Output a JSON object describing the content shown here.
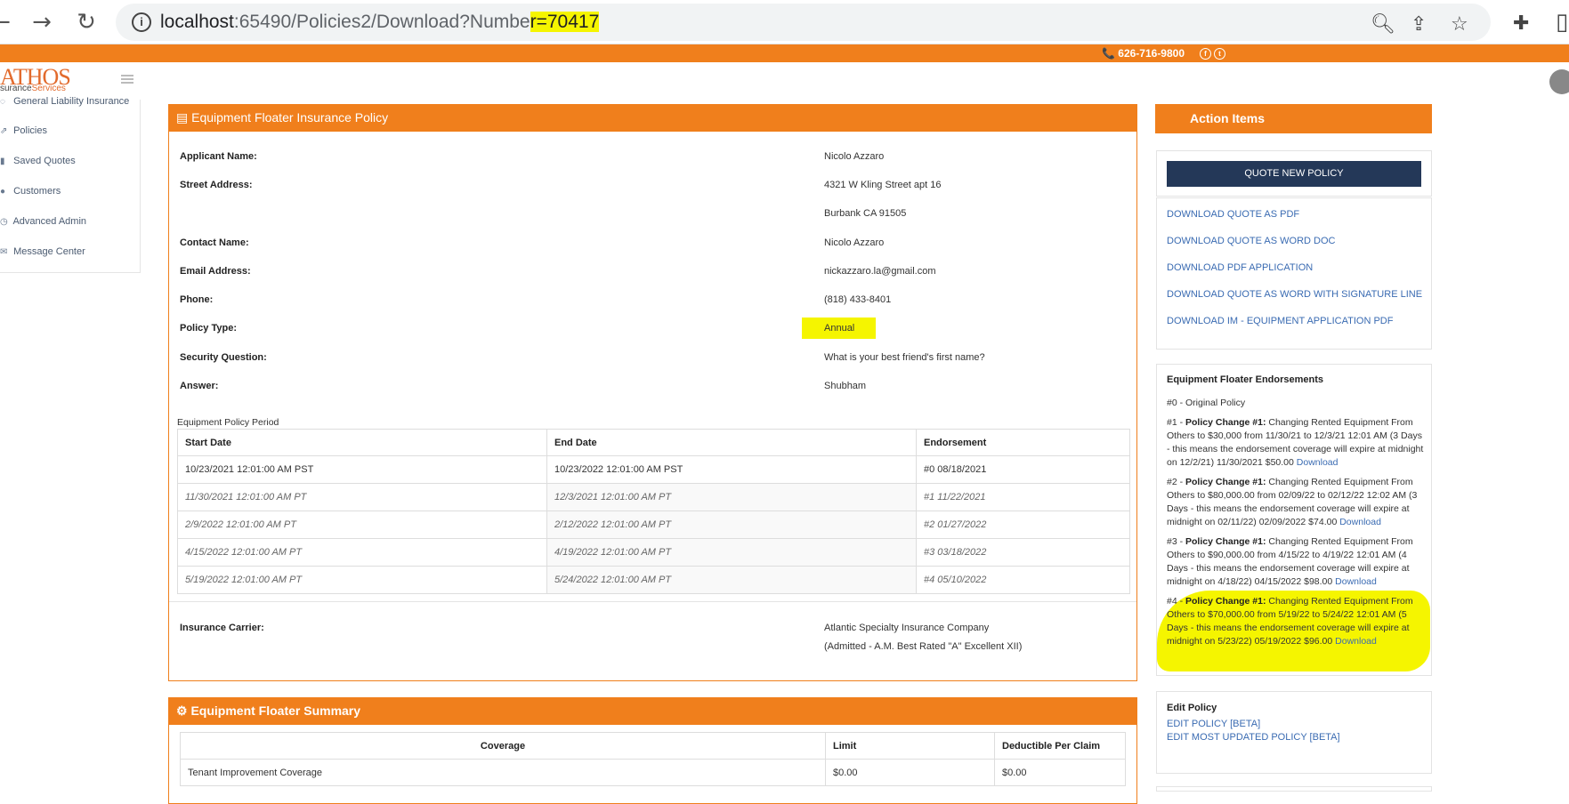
{
  "browser": {
    "url_host": "localhost",
    "url_path_pre": ":65490/Policies2/Download?Numbe",
    "url_highlighted": "r=70417"
  },
  "topbar": {
    "phone": "📞 626-716-9800"
  },
  "logo": {
    "main": "ATHOS",
    "sub_a": "surance",
    "sub_b": "Services"
  },
  "sidebar": {
    "items": [
      {
        "label": "General Liability Insurance",
        "icon": "shield-icon"
      },
      {
        "label": "Policies",
        "icon": "external-link-icon"
      },
      {
        "label": "Saved Quotes",
        "icon": "bookmark-icon"
      },
      {
        "label": "Customers",
        "icon": "users-icon"
      },
      {
        "label": "Advanced Admin",
        "icon": "clock-icon"
      },
      {
        "label": "Message Center",
        "icon": "envelope-icon"
      }
    ]
  },
  "policy": {
    "title": "Equipment Floater Insurance Policy",
    "fields": [
      {
        "label": "Applicant Name:",
        "value": "Nicolo Azzaro"
      },
      {
        "label": "Street Address:",
        "value": "4321 W Kling Street apt 16"
      },
      {
        "label": "",
        "value": "Burbank CA 91505"
      },
      {
        "label": "Contact Name:",
        "value": "Nicolo Azzaro"
      },
      {
        "label": "Email Address:",
        "value": "nickazzaro.la@gmail.com"
      },
      {
        "label": "Phone:",
        "value": "(818) 433-8401"
      },
      {
        "label": "Policy Type:",
        "value": "Annual"
      },
      {
        "label": "Security Question:",
        "value": "What is your best friend's first name?"
      },
      {
        "label": "Answer:",
        "value": "Shubham"
      }
    ],
    "period_caption": "Equipment Policy Period",
    "period_headers": [
      "Start Date",
      "End Date",
      "Endorsement"
    ],
    "period_rows": [
      [
        "10/23/2021 12:01:00 AM PST",
        "10/23/2022 12:01:00 AM PST",
        "#0 08/18/2021"
      ],
      [
        "11/30/2021 12:01:00 AM PT",
        "12/3/2021 12:01:00 AM PT",
        "#1  11/22/2021"
      ],
      [
        "2/9/2022 12:01:00 AM PT",
        "2/12/2022 12:01:00 AM PT",
        "#2  01/27/2022"
      ],
      [
        "4/15/2022 12:01:00 AM PT",
        "4/19/2022 12:01:00 AM PT",
        "#3  03/18/2022"
      ],
      [
        "5/19/2022 12:01:00 AM PT",
        "5/24/2022 12:01:00 AM PT",
        "#4  05/10/2022"
      ]
    ],
    "carrier_label": "Insurance Carrier:",
    "carrier_name": "Atlantic Specialty Insurance Company",
    "carrier_rating": "(Admitted - A.M. Best Rated \"A\" Excellent XII)"
  },
  "summary": {
    "title": "Equipment Floater Summary",
    "headers": [
      "Coverage",
      "Limit",
      "Deductible Per Claim"
    ],
    "rows": [
      [
        "Tenant Improvement Coverage",
        "$0.00",
        "$0.00"
      ]
    ]
  },
  "actions": {
    "title": "Action Items",
    "quote_button": "QUOTE NEW POLICY",
    "links": [
      "DOWNLOAD QUOTE AS PDF",
      "DOWNLOAD QUOTE AS WORD DOC",
      "DOWNLOAD PDF APPLICATION",
      "DOWNLOAD QUOTE AS WORD WITH SIGNATURE LINE",
      "DOWNLOAD IM - EQUIPMENT APPLICATION PDF"
    ],
    "endorsements_title": "Equipment Floater Endorsements",
    "endorsement0": "#0 - Original Policy",
    "endorsements": [
      {
        "num": "#1 - ",
        "bold": "Policy Change #1:",
        "text": " Changing Rented Equipment From Others to $30,000 from 11/30/21 to 12/3/21 12:01 AM (3 Days - this means the endorsement coverage will expire at midnight on 12/2/21) 11/30/2021 $50.00 ",
        "link": "Download"
      },
      {
        "num": "#2 - ",
        "bold": "Policy Change #1:",
        "text": " Changing Rented Equipment From Others to $80,000.00 from 02/09/22 to 02/12/22 12:02 AM (3 Days - this means the endorsement coverage will expire at midnight on 02/11/22) 02/09/2022 $74.00 ",
        "link": "Download"
      },
      {
        "num": "#3 - ",
        "bold": "Policy Change #1:",
        "text": " Changing Rented Equipment From Others to $90,000.00 from 4/15/22 to 4/19/22 12:01 AM (4 Days - this means the endorsement coverage will expire at midnight on 4/18/22) 04/15/2022 $98.00 ",
        "link": "Download"
      },
      {
        "num": "#4 - ",
        "bold": "Policy Change #1:",
        "text": " Changing Rented Equipment From Others to $70,000.00 from 5/19/22 to 5/24/22 12:01 AM (5 Days - this means the endorsement coverage will expire at midnight on 5/23/22) 05/19/2022 $96.00 ",
        "link": "Download"
      }
    ],
    "edit_title": "Edit Policy",
    "edit_links": [
      "EDIT POLICY [BETA]",
      "EDIT MOST UPDATED POLICY [BETA]"
    ]
  }
}
